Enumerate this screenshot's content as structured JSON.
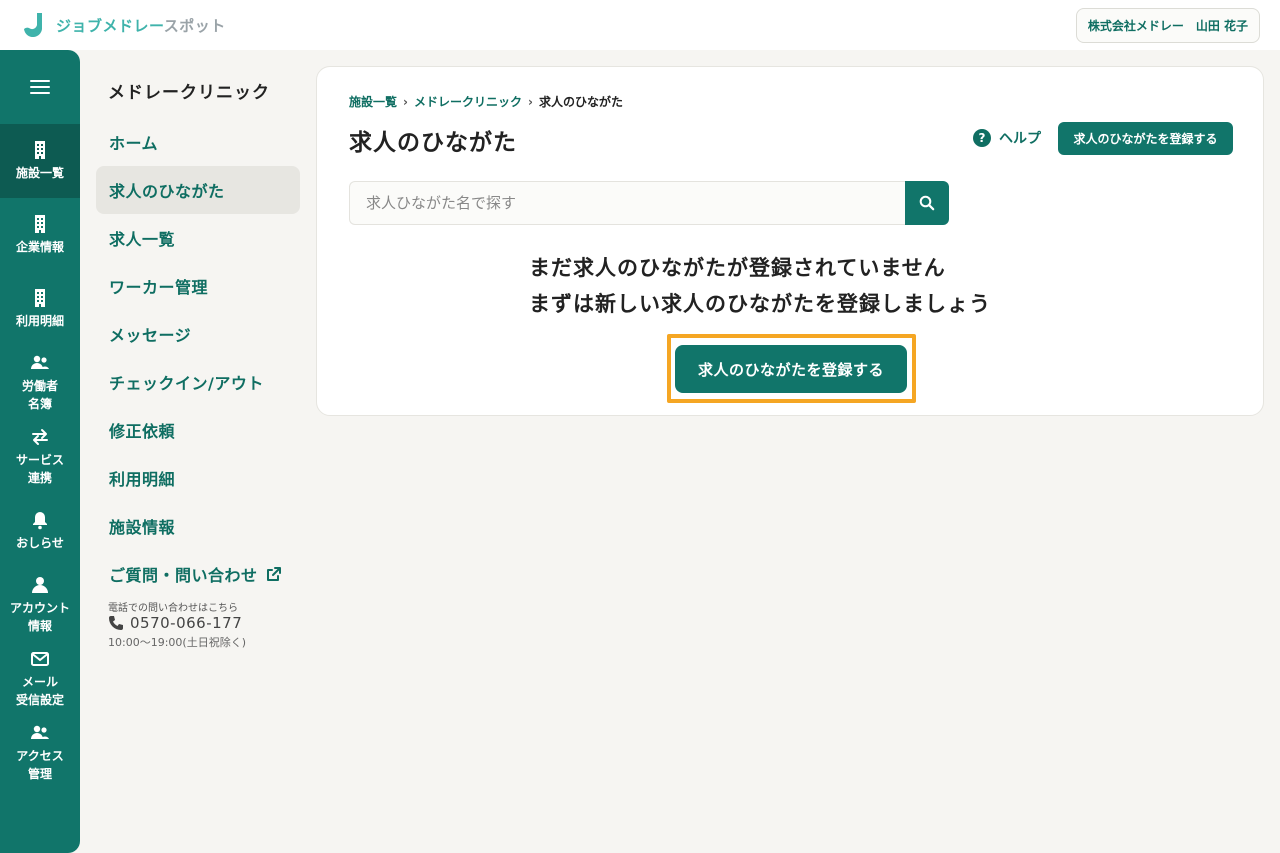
{
  "header": {
    "logo_text_main": "ジョブメドレー",
    "logo_text_sub": "スポット",
    "account": "株式会社メドレー　山田 花子"
  },
  "rail": {
    "items": [
      {
        "label1": "施設一覧",
        "label2": "",
        "icon": "building-icon",
        "active": true
      },
      {
        "label1": "企業情報",
        "label2": "",
        "icon": "building-icon"
      },
      {
        "label1": "利用明細",
        "label2": "",
        "icon": "building-icon"
      },
      {
        "label1": "労働者",
        "label2": "名簿",
        "icon": "users-icon"
      },
      {
        "label1": "サービス",
        "label2": "連携",
        "icon": "swap-arrows-icon"
      },
      {
        "label1": "おしらせ",
        "label2": "",
        "icon": "bell-icon"
      },
      {
        "label1": "アカウント",
        "label2": "情報",
        "icon": "user-icon"
      },
      {
        "label1": "メール",
        "label2": "受信設定",
        "icon": "mail-icon"
      },
      {
        "label1": "アクセス",
        "label2": "管理",
        "icon": "users-icon"
      }
    ]
  },
  "subnav": {
    "title": "メドレークリニック",
    "items": [
      {
        "label": "ホーム"
      },
      {
        "label": "求人のひながた",
        "active": true
      },
      {
        "label": "求人一覧"
      },
      {
        "label": "ワーカー管理"
      },
      {
        "label": "メッセージ"
      },
      {
        "label": "チェックイン/アウト"
      },
      {
        "label": "修正依頼"
      },
      {
        "label": "利用明細"
      },
      {
        "label": "施設情報"
      },
      {
        "label": "ご質問・問い合わせ"
      }
    ],
    "contact_note": "電話での問い合わせはこちら",
    "phone": "0570-066-177",
    "hours": "10:00〜19:00(土日祝除く)"
  },
  "main": {
    "breadcrumb": [
      "施設一覧",
      "メドレークリニック",
      "求人のひながた"
    ],
    "title": "求人のひながた",
    "help_label": "ヘルプ",
    "register_button": "求人のひながたを登録する",
    "search_placeholder": "求人ひながた名で探す",
    "empty_line1": "まだ求人のひながたが登録されていません",
    "empty_line2": "まずは新しい求人のひながたを登録しましょう",
    "empty_button": "求人のひながたを登録する"
  },
  "colors": {
    "brand": "#11756a",
    "brand_dark": "#0d5b52",
    "highlight": "#f5a623",
    "logo": "#3fb3ab"
  }
}
